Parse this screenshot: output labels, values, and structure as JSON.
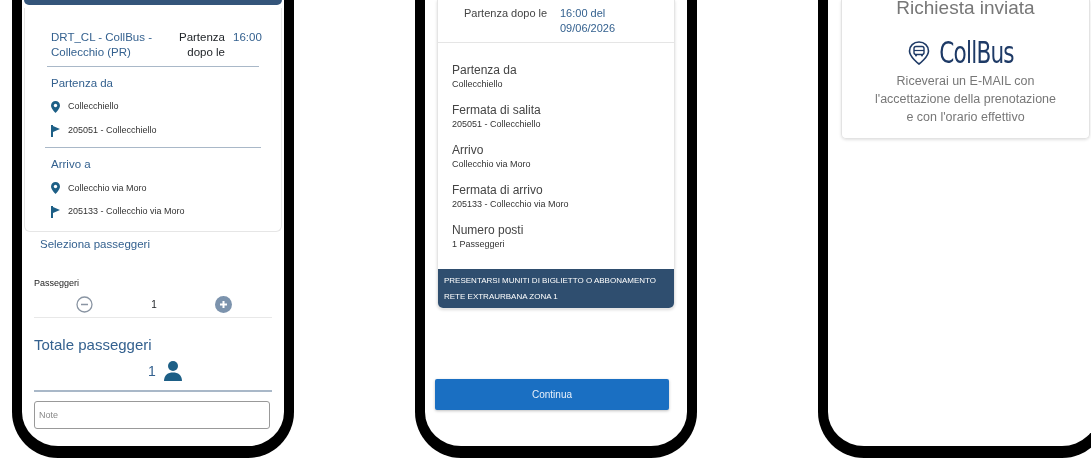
{
  "screens": [
    {
      "kind": "booking_form",
      "route": "DRT_CL - CollBus - Collecchio (PR)",
      "departure_label": "Partenza dopo le",
      "departure_time": "16:00",
      "sections": [
        {
          "title": "Partenza da",
          "place": "Collecchiello",
          "stop": "205051 - Collecchiello"
        },
        {
          "title": "Arrivo a",
          "place": "Collecchio via Moro",
          "stop": "205133 - Collecchio via Moro"
        }
      ],
      "passengers": {
        "heading": "Seleziona passeggeri",
        "label": "Passeggeri",
        "count": "1",
        "total_heading": "Totale passeggeri",
        "total": "1"
      },
      "note": {
        "placeholder": "Note"
      }
    },
    {
      "kind": "summary",
      "departure_label": "Partenza dopo le",
      "departure_value": "16:00 del 09/06/2026",
      "details": [
        {
          "label": "Partenza da",
          "value": "Collecchiello"
        },
        {
          "label": "Fermata di salita",
          "value": "205051 - Collecchiello"
        },
        {
          "label": "Arrivo",
          "value": "Collecchio via Moro"
        },
        {
          "label": "Fermata di arrivo",
          "value": "205133 - Collecchio via Moro"
        },
        {
          "label": "Numero posti",
          "value": "1 Passeggeri"
        }
      ],
      "notice": "PRESENTARSI MUNITI DI BIGLIETTO O ABBONAMENTO RETE EXTRAURBANA ZONA 1",
      "button": "Continua"
    },
    {
      "kind": "confirmation",
      "title": "Richiesta inviata",
      "logo_text": "CollBus",
      "message": "Riceverai un E-MAIL con l'accettazione della prenotazione e con l'orario effettivo"
    }
  ]
}
